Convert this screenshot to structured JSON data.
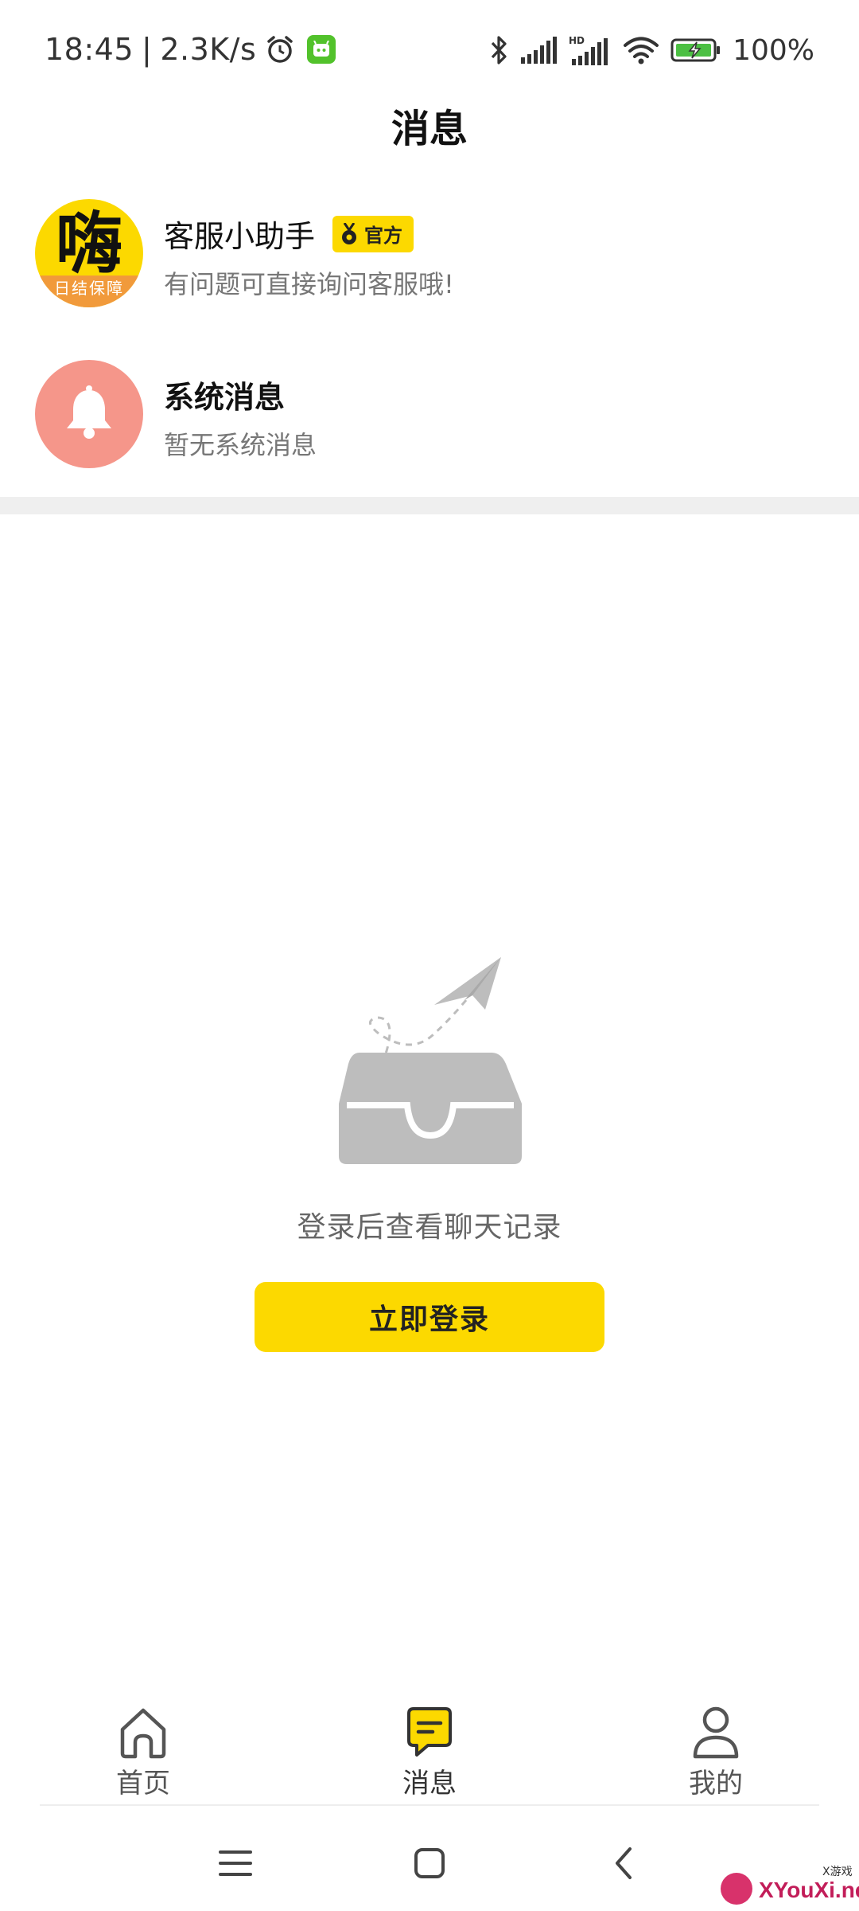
{
  "status_bar": {
    "time": "18:45",
    "separator": "|",
    "net_speed": "2.3K/s",
    "battery": "100%",
    "icons": [
      "alarm-icon",
      "app-notification-icon",
      "bluetooth-icon",
      "signal-icon",
      "hd-signal-icon",
      "wifi-icon",
      "battery-charging-icon"
    ]
  },
  "header": {
    "title": "消息"
  },
  "conversations": [
    {
      "avatar_glyph": "嗨",
      "avatar_ribbon": "日结保障",
      "name": "客服小助手",
      "badge": "官方",
      "preview": "有问题可直接询问客服哦!"
    },
    {
      "avatar_icon": "bell-icon",
      "name": "系统消息",
      "preview": "暂无系统消息"
    }
  ],
  "empty_state": {
    "message": "登录后查看聊天记录",
    "button_label": "立即登录",
    "icon": "paper-plane-inbox-icon"
  },
  "bottom_nav": {
    "items": [
      {
        "label": "首页",
        "icon": "home-icon",
        "active": false
      },
      {
        "label": "消息",
        "icon": "message-icon",
        "active": true
      },
      {
        "label": "我的",
        "icon": "profile-icon",
        "active": false
      }
    ]
  },
  "watermark": {
    "text": "XYouXi.net",
    "small": "X游戏"
  },
  "colors": {
    "accent": "#fcd900",
    "bell_avatar": "#f5968a",
    "ribbon": "#f19a3b",
    "divider": "#efefef"
  }
}
